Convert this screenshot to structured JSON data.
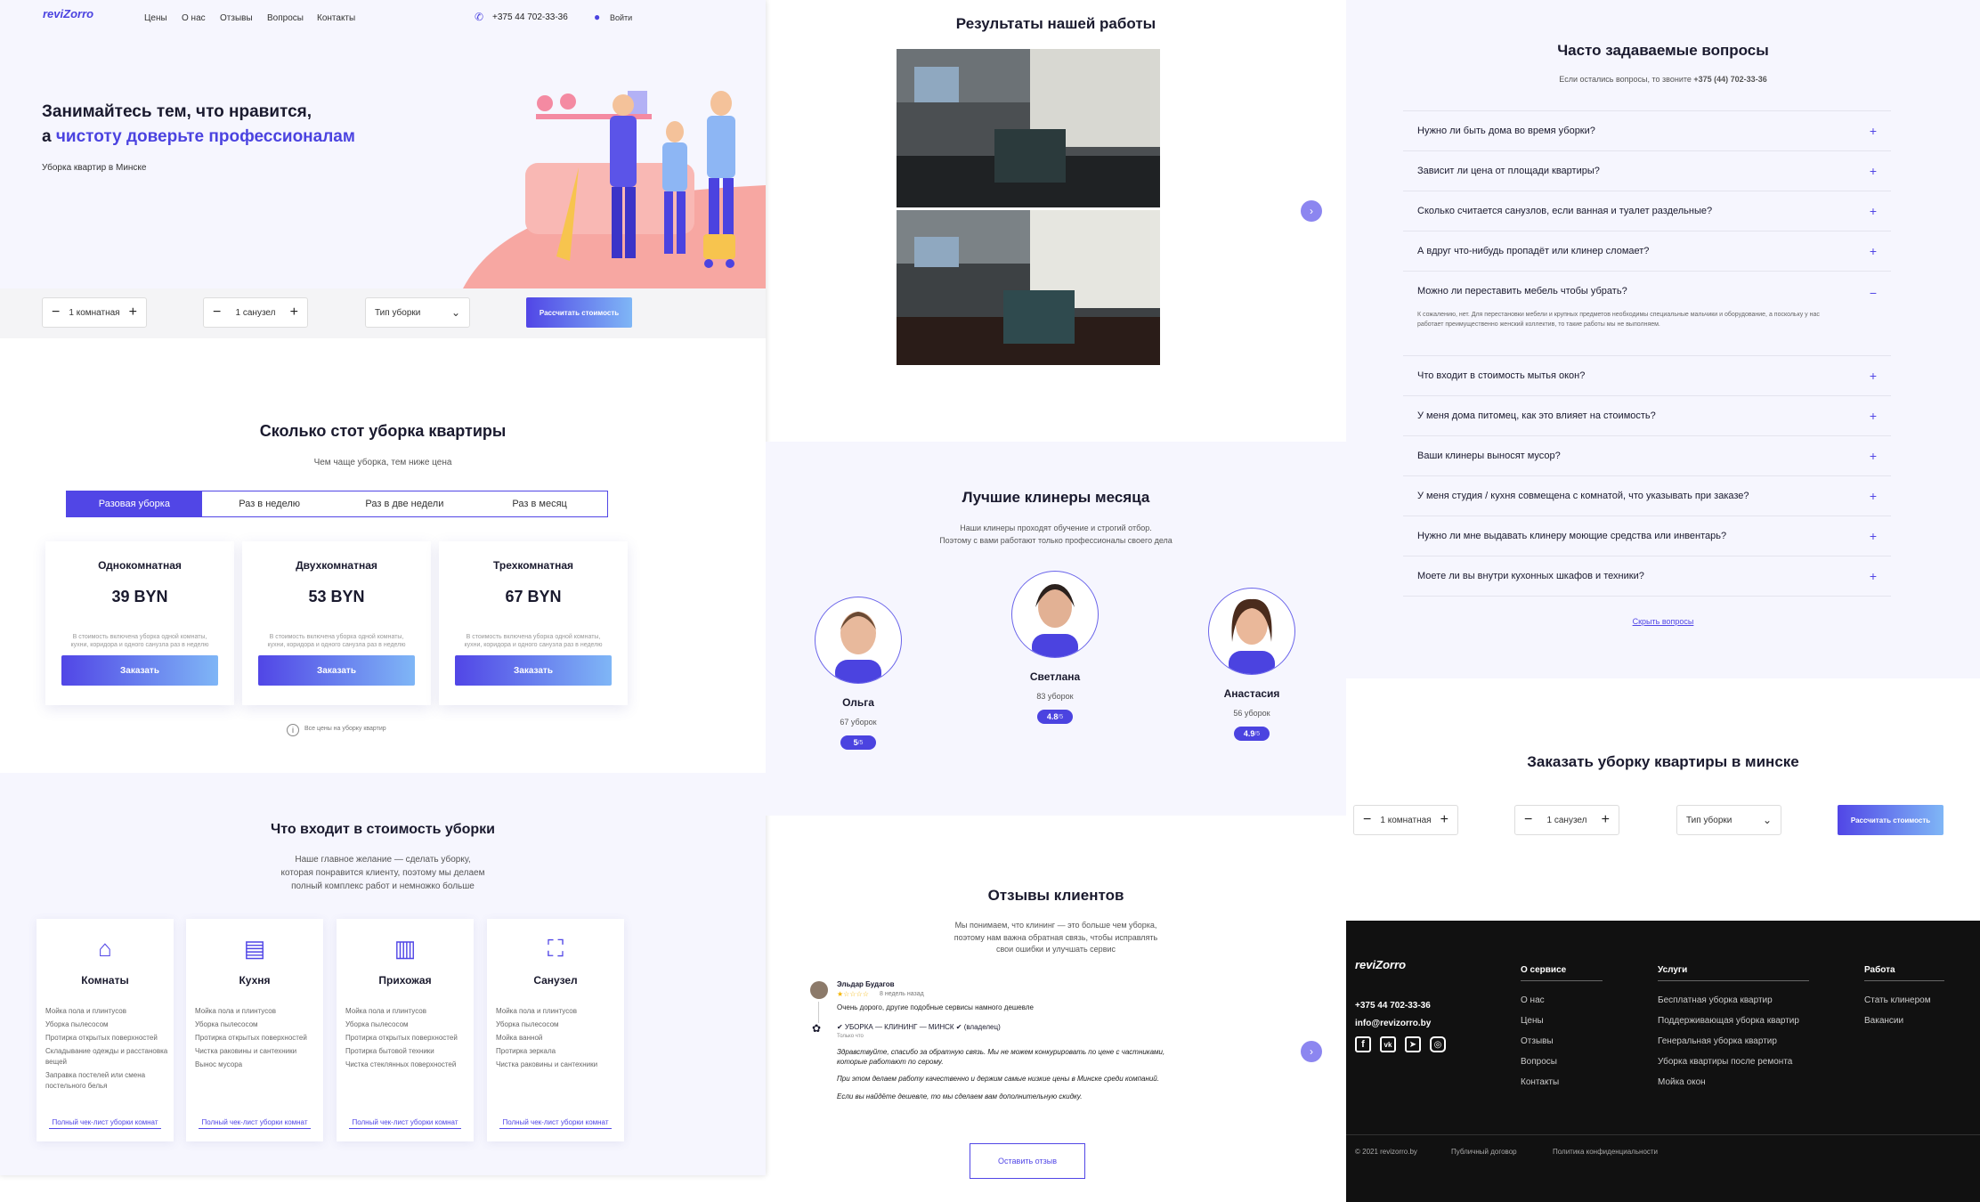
{
  "header": {
    "logo": "reviZorro",
    "nav": [
      "Цены",
      "О нас",
      "Отзывы",
      "Вопросы",
      "Контакты"
    ],
    "phone": "+375 44 702-33-36",
    "login": "Войти"
  },
  "hero": {
    "title_line1": "Занимайтесь тем, что нравится,",
    "title_line2_prefix": "а ",
    "title_line2_accent": "чистоту доверьте профессионалам",
    "subtitle": "Уборка квартир в Минске"
  },
  "calc": {
    "rooms": "1 комнатная",
    "rooms_short": "1 комнатная",
    "baths": "1 санузел",
    "type_placeholder": "Тип уборки",
    "button": "Рассчитать стоимость",
    "minus": "−",
    "plus": "+"
  },
  "pricing": {
    "title": "Сколько стот уборка квартиры",
    "subtitle": "Чем чаще уборка, тем ниже цена",
    "tabs": [
      "Разовая уборка",
      "Раз в неделю",
      "Раз в две недели",
      "Раз в месяц"
    ],
    "cards": [
      {
        "name": "Однокомнатная",
        "price": "39 BYN",
        "desc": "В стоимость включена уборка одной комнаты, кухни, коридора и одного санузла раз в неделю",
        "button": "Заказать"
      },
      {
        "name": "Двухкомнатная",
        "price": "53 BYN",
        "desc": "В стоимость включена уборка одной комнаты, кухни, коридора и одного санузла раз в неделю",
        "button": "Заказать"
      },
      {
        "name": "Трехкомнатная",
        "price": "67 BYN",
        "desc": "В стоимость включена уборка одной комнаты, кухни, коридора и одного санузла раз в неделю",
        "button": "Заказать"
      }
    ],
    "all_prices": "Все цены на уборку квартир"
  },
  "included": {
    "title": "Что входит в стоимость уборки",
    "subtitle_l1": "Наше главное желание — сделать уборку,",
    "subtitle_l2": "которая понравится клиенту, поэтому мы делаем",
    "subtitle_l3": "полный комплекс работ и немножко больше",
    "cards": [
      {
        "name": "Комнаты",
        "items": [
          "Мойка пола и плинтусов",
          "Уборка пылесосом",
          "Протирка открытых поверхностей",
          "Складывание одежды и расстановка вещей",
          "Заправка постелей или смена постельного белья"
        ],
        "link": "Полный чек-лист уборки комнат"
      },
      {
        "name": "Кухня",
        "items": [
          "Мойка пола и плинтусов",
          "Уборка пылесосом",
          "Протирка открытых поверхностей",
          "Чистка раковины и сантехники",
          "Вынос мусора"
        ],
        "link": "Полный чек-лист уборки комнат"
      },
      {
        "name": "Прихожая",
        "items": [
          "Мойка пола и плинтусов",
          "Уборка пылесосом",
          "Протирка открытых поверхностей",
          "Протирка бытовой техники",
          "Чистка стеклянных поверхностей"
        ],
        "link": "Полный чек-лист уборки комнат"
      },
      {
        "name": "Санузел",
        "items": [
          "Мойка пола и плинтусов",
          "Уборка пылесосом",
          "Мойка ванной",
          "Протирка зеркала",
          "Чистка раковины и сантехники"
        ],
        "link": "Полный чек-лист уборки комнат"
      }
    ]
  },
  "results": {
    "title": "Результаты нашей работы"
  },
  "cleaners": {
    "title": "Лучшие клинеры месяца",
    "subtitle_l1": "Наши клинеры проходят обучение и строгий отбор.",
    "subtitle_l2": "Поэтому с вами работают только профессионалы своего дела",
    "list": [
      {
        "name": "Ольга",
        "count": "67 уборок",
        "rating": "5",
        "of": "/5"
      },
      {
        "name": "Светлана",
        "count": "83 уборок",
        "rating": "4.8",
        "of": "/5"
      },
      {
        "name": "Анастасия",
        "count": "56 уборок",
        "rating": "4.9",
        "of": "/5"
      }
    ]
  },
  "reviews": {
    "title": "Отзывы клиентов",
    "subtitle_l1": "Мы понимаем, что клининг — это больше чем уборка,",
    "subtitle_l2": "поэтому нам важна обратная связь, чтобы исправлять",
    "subtitle_l3": "свои ошибки и улучшать сервис",
    "author": "Эльдар Будагов",
    "time": "8 недель назад",
    "text": "Очень дорого, другие подобные сервисы намного дешевле",
    "reply_author": "✔ УБОРКА — КЛИНИНГ — МИНСК ✔ (владелец)",
    "reply_time": "Только что",
    "reply_p1": "Здравствуйте, спасибо за обратную связь. Мы не можем конкурировать по цене с частниками, которые работают по серому.",
    "reply_p2": "При этом делаем работу качественно и держим самые низкие цены в Минске среди компаний.",
    "reply_p3": "Если вы найдёте дешевле, то мы сделаем вам дополнительную скидку.",
    "button": "Оставить отзыв"
  },
  "faq": {
    "title": "Часто задаваемые вопросы",
    "subtitle_prefix": "Если остались вопросы, то звоните ",
    "subtitle_phone": "+375 (44) 702-33-36",
    "items": [
      "Нужно ли быть дома во время уборки?",
      "Зависит ли цена от площади квартиры?",
      "Сколько считается санузлов, если ванная и туалет раздельные?",
      "А вдруг что-нибудь пропадёт или клинер сломает?",
      "Можно ли переставить мебель чтобы убрать?",
      "Что входит в стоимость мытья окон?",
      "У меня дома питомец, как это влияет на стоимость?",
      "Ваши клинеры выносят мусор?",
      "У меня студия / кухня совмещена с комнатой, что указывать при заказе?",
      "Нужно ли мне выдавать клинеру моющие средства или инвентарь?",
      "Моете ли вы внутри кухонных шкафов и техники?"
    ],
    "open_answer": "К сожалению, нет. Для перестановки мебели и крупных предметов необходимы специальные мальчики и оборудование, а поскольку у нас работает преимущественно женский коллектив, то такие работы мы не выполняем.",
    "hide": "Скрыть вопросы"
  },
  "order": {
    "title": "Заказать уборку квартиры в минске"
  },
  "footer": {
    "phone": "+375 44 702-33-36",
    "email": "info@revizorro.by",
    "col1_title": "О сервисе",
    "col1": [
      "О нас",
      "Цены",
      "Отзывы",
      "Вопросы",
      "Контакты"
    ],
    "col2_title": "Услуги",
    "col2": [
      "Бесплатная уборка квартир",
      "Поддерживающая уборка квартир",
      "Генеральная уборка квартир",
      "Уборка квартиры после ремонта",
      "Мойка окон"
    ],
    "col3_title": "Работа",
    "col3": [
      "Стать клинером",
      "Вакансии"
    ],
    "copyright": "© 2021 revizorro.by",
    "offer": "Публичный договор",
    "privacy": "Политика конфиденциальности"
  },
  "colors": {
    "accent": "#5146e6",
    "bg_light": "#f6f6fe",
    "footer_bg": "#111111"
  }
}
